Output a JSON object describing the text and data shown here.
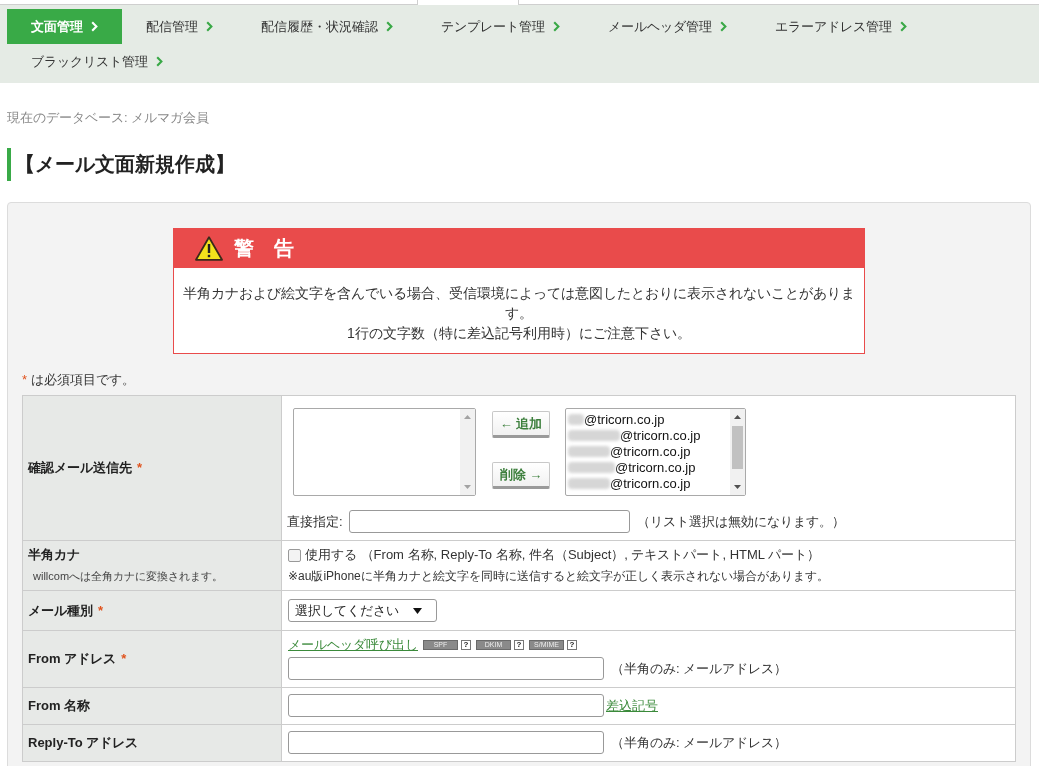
{
  "nav": {
    "items": [
      {
        "label": "文面管理",
        "selected": true
      },
      {
        "label": "配信管理",
        "selected": false
      },
      {
        "label": "配信履歴・状況確認",
        "selected": false
      },
      {
        "label": "テンプレート管理",
        "selected": false
      },
      {
        "label": "メールヘッダ管理",
        "selected": false
      },
      {
        "label": "エラーアドレス管理",
        "selected": false
      },
      {
        "label": "ブラックリスト管理",
        "selected": false
      }
    ]
  },
  "database_line": "現在のデータベース: メルマガ会員",
  "heading": "【メール文面新規作成】",
  "warning": {
    "title": "警　告",
    "lines": [
      "半角カナおよび絵文字を含んでいる場合、受信環境によっては意図したとおりに表示されないことがあります。",
      "1行の文字数（特に差込記号利用時）にご注意下さい。"
    ]
  },
  "required_note": {
    "mark": "*",
    "text": "は必須項目です。"
  },
  "form": {
    "rows": [
      {
        "kind": "recipients",
        "label": "確認メール送信先",
        "mark": "*",
        "add_button": "← 追加",
        "remove_button": "削除 →",
        "address_list": [
          {
            "text": "@tricorn.co.jp",
            "redacted": true
          },
          {
            "text": "@tricorn.co.jp",
            "redacted": true
          },
          {
            "text": "@tricorn.co.jp",
            "redacted": true
          },
          {
            "text": "@tricorn.co.jp",
            "redacted": true
          },
          {
            "text": "@tricorn.co.jp",
            "redacted": true
          }
        ],
        "direct_label": "直接指定:",
        "direct_note": "（リスト選択は無効になります。）"
      },
      {
        "kind": "checkbox",
        "label": "半角カナ",
        "sublabel": "willcomへは全角カナに変換されます。",
        "option": {
          "label": "使用する （From 名称, Reply-To 名称, 件名（Subject）, テキストパート, HTML パート）",
          "checked": false
        },
        "note": "※au版iPhoneに半角カナと絵文字を同時に送信すると絵文字が正しく表示されない場合があります。"
      },
      {
        "kind": "select",
        "label": "メール種別",
        "mark": "*",
        "value": "選択してください"
      },
      {
        "kind": "input",
        "label": "From アドレス",
        "mark": "*",
        "link": "メールヘッダ呼び出し",
        "badges": [
          {
            "label": "SPF",
            "help": "?"
          },
          {
            "label": "DKIM",
            "help": "?"
          },
          {
            "label": "S/MIME",
            "help": "?"
          }
        ],
        "hint": "（半角のみ: メールアドレス）"
      },
      {
        "kind": "input",
        "label": "From 名称",
        "side_link": "差込記号"
      },
      {
        "kind": "input",
        "label": "Reply-To アドレス",
        "hint": "（半角のみ: メールアドレス）"
      }
    ]
  }
}
